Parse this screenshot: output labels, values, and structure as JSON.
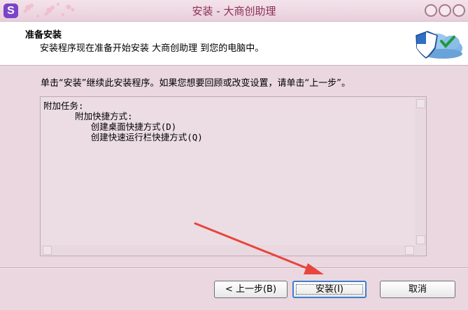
{
  "window": {
    "title": "安装 - 大商创助理"
  },
  "header": {
    "title": "准备安装",
    "subtitle": "安装程序现在准备开始安装 大商创助理 到您的电脑中。"
  },
  "main": {
    "instruction": "单击“安装”继续此安装程序。如果您想要回顾或改变设置，请单击“上一步”。",
    "memo_lines": [
      "附加任务:",
      "      附加快捷方式:",
      "         创建桌面快捷方式(D)",
      "         创建快速运行栏快捷方式(Q)"
    ]
  },
  "buttons": {
    "back": "< 上一步(B)",
    "install": "安装(I)",
    "cancel": "取消"
  },
  "colors": {
    "title_text": "#8b2f57",
    "annotation_arrow": "#e8453c",
    "default_button_border": "#3d7fcf"
  }
}
